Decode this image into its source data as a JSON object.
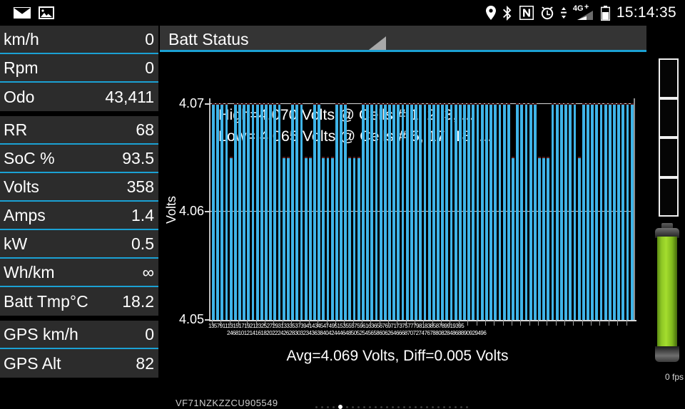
{
  "statusbar": {
    "left_icons": [
      "mail-icon",
      "image-icon"
    ],
    "right_icons": [
      "location-icon",
      "bluetooth-icon",
      "nfc-icon",
      "alarm-icon",
      "data-sync-icon",
      "signal-4g-plus-icon",
      "battery-icon"
    ],
    "network_label": "4G",
    "network_plus": "+",
    "clock": "15:14:35"
  },
  "sidebar": {
    "groups": [
      {
        "rows": [
          {
            "label": "km/h",
            "value": "0"
          },
          {
            "label": "Rpm",
            "value": "0"
          },
          {
            "label": "Odo",
            "value": "43,411"
          }
        ]
      },
      {
        "rows": [
          {
            "label": "RR",
            "value": "68"
          },
          {
            "label": "SoC %",
            "value": "93.5"
          },
          {
            "label": "Volts",
            "value": "358"
          },
          {
            "label": "Amps",
            "value": "1.4"
          },
          {
            "label": "kW",
            "value": "0.5"
          },
          {
            "label": "Wh/km",
            "value": "∞"
          },
          {
            "label": "Batt Tmp°C",
            "value": "18.2"
          }
        ]
      },
      {
        "rows": [
          {
            "label": "GPS km/h",
            "value": "0"
          },
          {
            "label": "GPS Alt",
            "value": "82"
          }
        ]
      }
    ],
    "accent_color": "#1ba1d4",
    "row_bg": "#2c2c2c"
  },
  "main": {
    "title": "Batt Status",
    "vin": "VF71NZKZZCU905549",
    "fps": "0 fps",
    "page_dots": {
      "count": 27,
      "active_index": 4
    }
  },
  "chart_data": {
    "type": "bar",
    "title": "Batt Status",
    "annotations": [
      "High=4.070 Volts @ Cells # 1, 2, 3,  ...",
      "Low= 4.065 Volts @ Cells # 5, 17, 18,  ..."
    ],
    "footer": "Avg=4.069 Volts, Diff=0.005 Volts",
    "high_volts": 4.07,
    "high_cells": "1, 2, 3,  ...",
    "low_volts": 4.065,
    "low_cells": "5, 17, 18,  ...",
    "avg_volts": 4.069,
    "diff_volts": 0.005,
    "xlabel": "",
    "ylabel": "Volts",
    "ylim": [
      4.05,
      4.0705
    ],
    "yticks": [
      4.05,
      4.06,
      4.07
    ],
    "ytick_labels": [
      "4.05",
      "4.06",
      "4.07"
    ],
    "grid": true,
    "bar_color": "#3fb4e8",
    "n_cells": 96,
    "categories": [
      1,
      2,
      3,
      4,
      5,
      6,
      7,
      8,
      9,
      10,
      11,
      12,
      13,
      14,
      15,
      16,
      17,
      18,
      19,
      20,
      21,
      22,
      23,
      24,
      25,
      26,
      27,
      28,
      29,
      30,
      31,
      32,
      33,
      34,
      35,
      36,
      37,
      38,
      39,
      40,
      41,
      42,
      43,
      44,
      45,
      46,
      47,
      48,
      49,
      50,
      51,
      52,
      53,
      54,
      55,
      56,
      57,
      58,
      59,
      60,
      61,
      62,
      63,
      64,
      65,
      66,
      67,
      68,
      69,
      70,
      71,
      72,
      73,
      74,
      75,
      76,
      77,
      78,
      79,
      80,
      81,
      82,
      83,
      84,
      85,
      86,
      87,
      88,
      89,
      90,
      91,
      92,
      93,
      94,
      95,
      96
    ],
    "values": [
      4.07,
      4.07,
      4.07,
      4.07,
      4.065,
      4.07,
      4.07,
      4.07,
      4.07,
      4.07,
      4.07,
      4.07,
      4.07,
      4.07,
      4.07,
      4.07,
      4.065,
      4.065,
      4.07,
      4.07,
      4.07,
      4.065,
      4.065,
      4.07,
      4.07,
      4.065,
      4.065,
      4.065,
      4.07,
      4.07,
      4.07,
      4.065,
      4.065,
      4.065,
      4.07,
      4.07,
      4.07,
      4.07,
      4.07,
      4.07,
      4.07,
      4.07,
      4.07,
      4.07,
      4.07,
      4.07,
      4.07,
      4.07,
      4.07,
      4.07,
      4.07,
      4.07,
      4.07,
      4.07,
      4.07,
      4.07,
      4.07,
      4.07,
      4.07,
      4.07,
      4.07,
      4.07,
      4.07,
      4.07,
      4.07,
      4.07,
      4.07,
      4.07,
      4.065,
      4.07,
      4.07,
      4.07,
      4.07,
      4.07,
      4.065,
      4.065,
      4.065,
      4.07,
      4.07,
      4.07,
      4.07,
      4.07,
      4.07,
      4.065,
      4.07,
      4.07,
      4.07,
      4.07,
      4.07,
      4.07,
      4.07,
      4.07,
      4.07,
      4.07,
      4.07,
      4.07
    ]
  },
  "rail": {
    "segment_count": 4,
    "segments_filled": 0,
    "battery_level_color": "#9acd32"
  }
}
